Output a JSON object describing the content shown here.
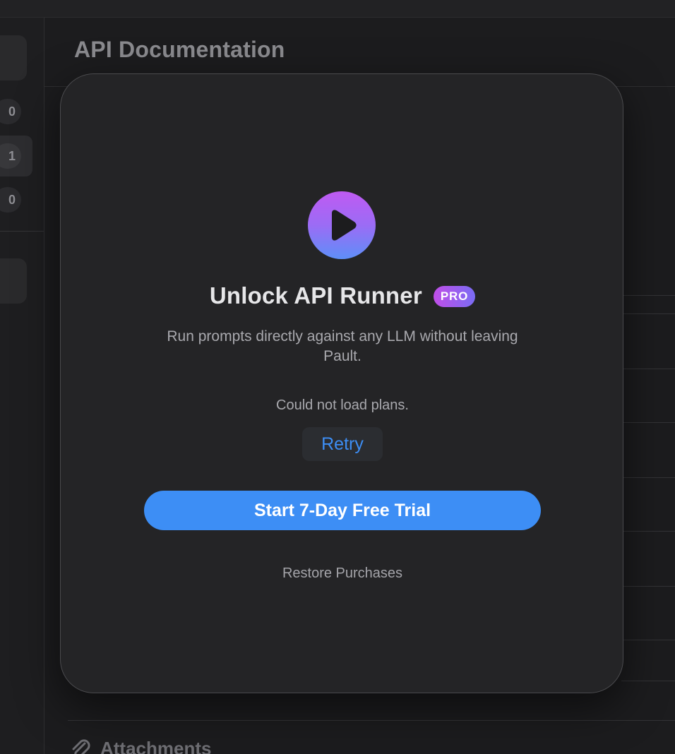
{
  "background": {
    "page_title": "API Documentation",
    "sidebar_counts": [
      "0",
      "1",
      "0"
    ],
    "attachments_label": "Attachments"
  },
  "modal": {
    "app_icon": "play-icon",
    "title": "Unlock API Runner",
    "badge": "PRO",
    "description": "Run prompts directly against any LLM without leaving Pault.",
    "error_message": "Could not load plans.",
    "retry_label": "Retry",
    "trial_button_label": "Start 7-Day Free Trial",
    "restore_label": "Restore Purchases"
  },
  "colors": {
    "accent": "#3d8ef5",
    "icon_gradient_top": "#bf5af2",
    "icon_gradient_bottom": "#5e8ff8",
    "modal_background": "#242426"
  }
}
